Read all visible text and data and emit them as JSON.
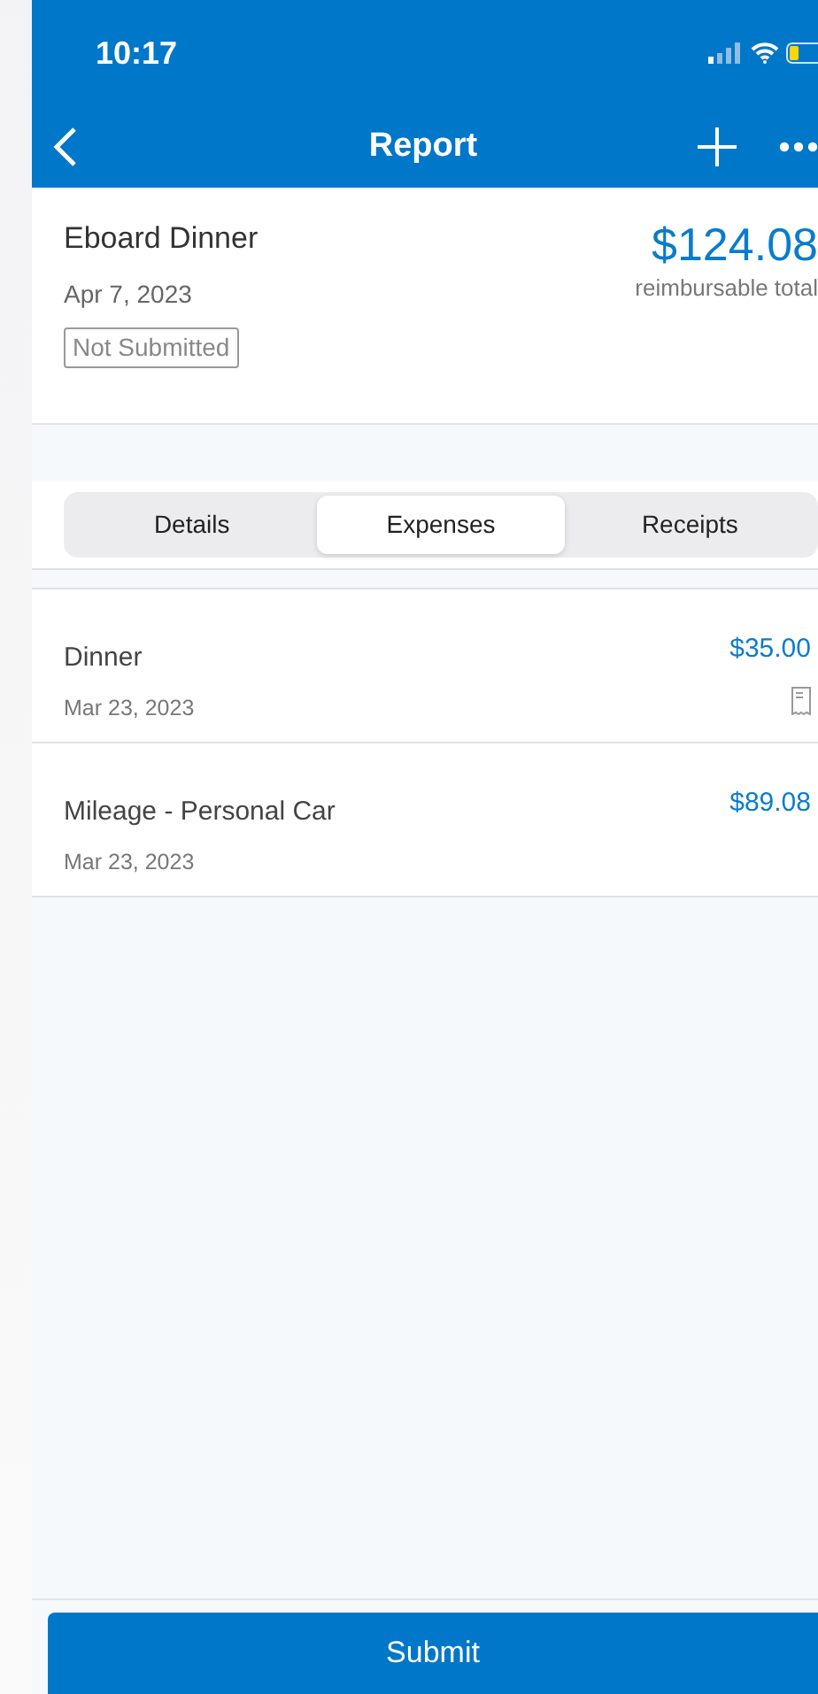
{
  "status_bar": {
    "time": "10:17"
  },
  "nav": {
    "title": "Report"
  },
  "report": {
    "name": "Eboard Dinner",
    "date": "Apr 7, 2023",
    "status": "Not Submitted",
    "total": "$124.08",
    "total_label": "reimbursable total"
  },
  "tabs": [
    {
      "label": "Details",
      "selected": false
    },
    {
      "label": "Expenses",
      "selected": true
    },
    {
      "label": "Receipts",
      "selected": false
    }
  ],
  "expenses": [
    {
      "name": "Dinner",
      "date": "Mar 23, 2023",
      "amount": "$35.00",
      "has_receipt": true
    },
    {
      "name": "Mileage - Personal Car",
      "date": "Mar 23, 2023",
      "amount": "$89.08",
      "has_receipt": false
    }
  ],
  "submit_button": "Submit"
}
